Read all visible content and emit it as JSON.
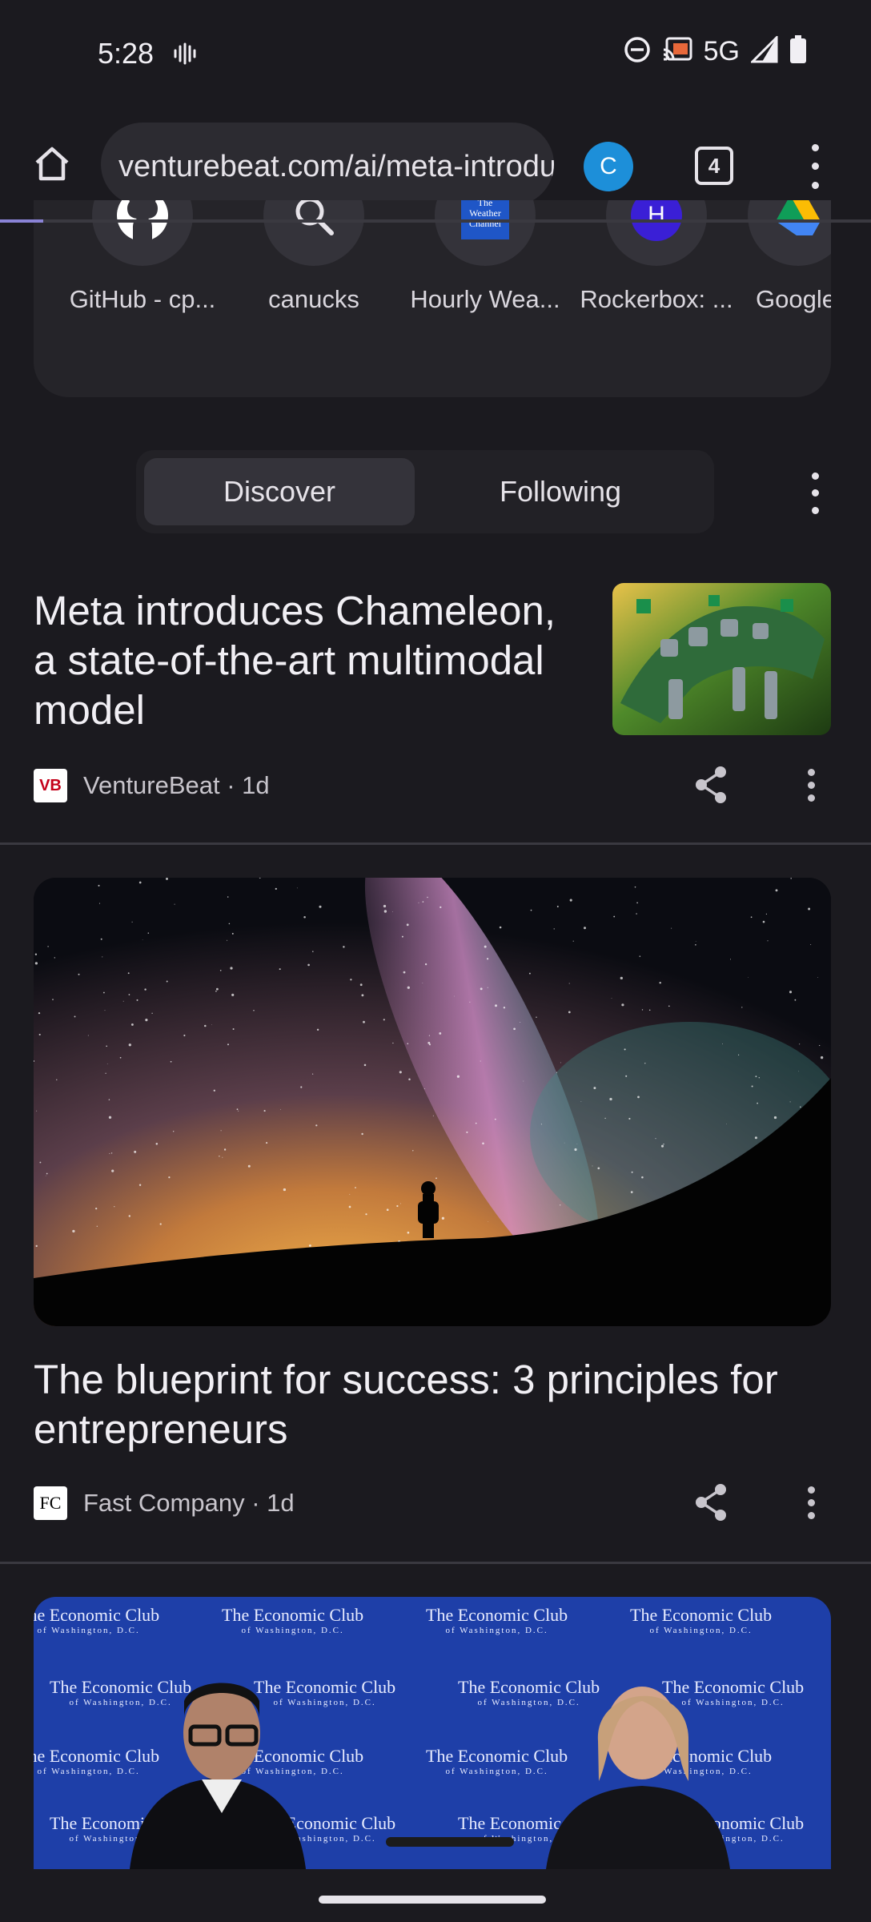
{
  "status_bar": {
    "time": "5:28",
    "network": "5G",
    "icons": [
      "vibrate-icon",
      "do-not-disturb-icon",
      "cast-icon",
      "signal-icon",
      "battery-icon"
    ]
  },
  "toolbar": {
    "url": "venturebeat.com/ai/meta-introduces-chameleon",
    "profile_initial": "C",
    "tab_count": "4",
    "load_progress": 0.05
  },
  "shortcuts": [
    {
      "label": "GitHub - cp...",
      "icon": "github-icon"
    },
    {
      "label": "canucks",
      "icon": "search-icon"
    },
    {
      "label": "Hourly Wea...",
      "icon": "weather-channel-icon",
      "icon_text": "The Weather Channel"
    },
    {
      "label": "Rockerbox: ...",
      "icon": "letter-avatar-icon",
      "icon_text": "H"
    },
    {
      "label": "Google",
      "icon": "google-drive-icon"
    }
  ],
  "feed": {
    "tabs": [
      "Discover",
      "Following"
    ],
    "active_tab": "Discover"
  },
  "articles": [
    {
      "headline": "Meta introduces Chameleon, a state-of-the-art multimodal model",
      "source": "VentureBeat",
      "age": "1d",
      "logo_text": "VB",
      "meta_text": "VentureBeat · 1d"
    },
    {
      "headline": "The blueprint for success: 3 principles for entrepreneurs",
      "source": "Fast Company",
      "age": "1d",
      "logo_text": "FC",
      "meta_text": "Fast Company · 1d"
    },
    {
      "banner_text": "The Economic Club",
      "banner_subtext": "of Washington, D.C."
    }
  ],
  "colors": {
    "background": "#1b1a1f",
    "surface": "#2c2b31",
    "accent": "#8a83d6",
    "profile": "#1d8fd9",
    "avatar_h": "#3a1fd6"
  }
}
